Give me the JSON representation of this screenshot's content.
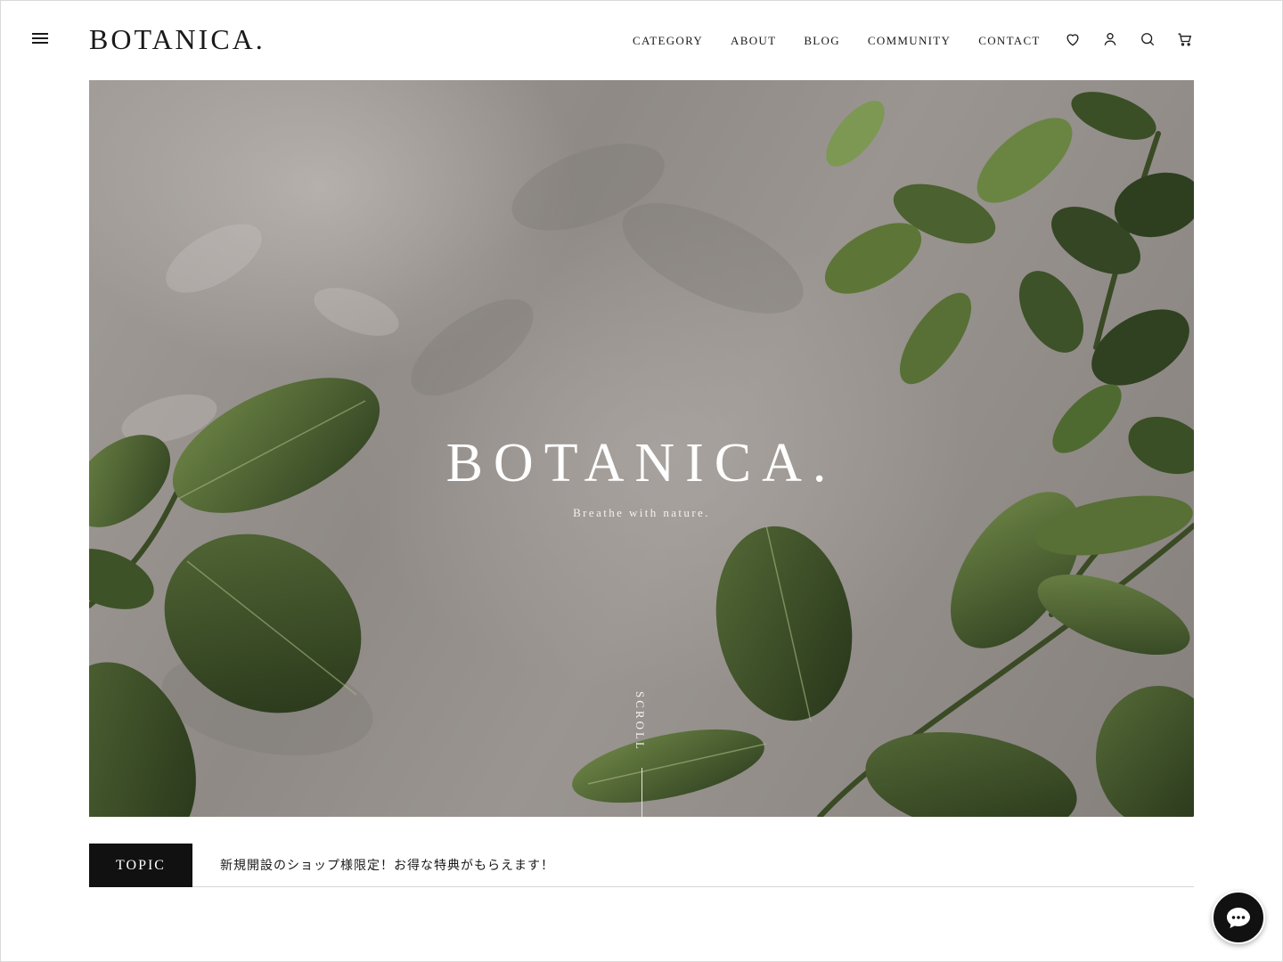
{
  "header": {
    "logo": "BOTANICA.",
    "nav": [
      "CATEGORY",
      "ABOUT",
      "BLOG",
      "COMMUNITY",
      "CONTACT"
    ],
    "icons": [
      "menu-icon",
      "heart-icon",
      "user-icon",
      "search-icon",
      "cart-icon"
    ]
  },
  "hero": {
    "title": "BOTANICA.",
    "subtitle": "Breathe with nature.",
    "scroll_label": "SCROLL"
  },
  "topic": {
    "label": "TOPIC",
    "text": "新規開設のショップ様限定！お得な特典がもらえます！"
  },
  "chat": {
    "icon": "chat-bubble-icon"
  },
  "colors": {
    "text": "#1a1a1a",
    "topic_bg": "#111111",
    "leaf": "#3d5228"
  }
}
